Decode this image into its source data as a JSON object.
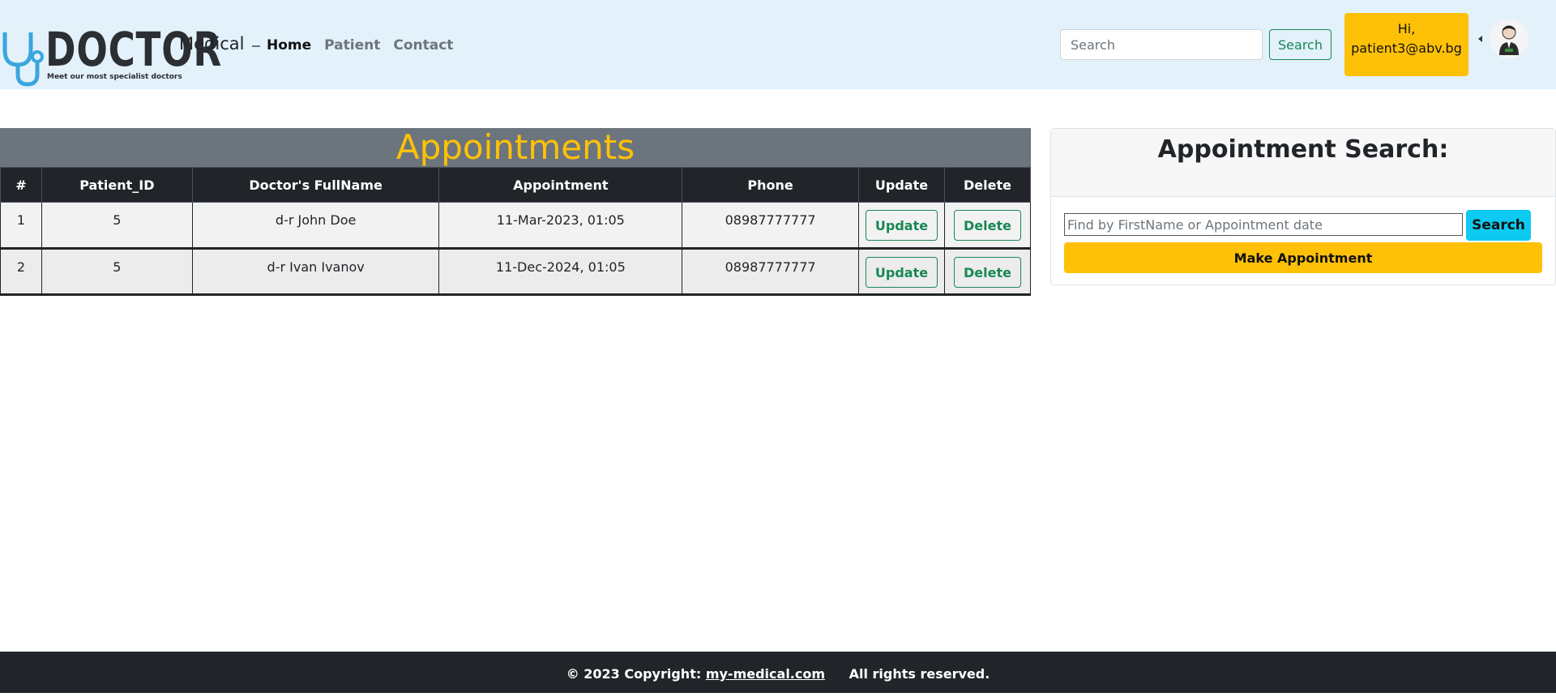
{
  "navbar": {
    "logo_word": "DOCTOR",
    "logo_tagline": "Meet our most specialist doctors",
    "brand": "Medical",
    "links": [
      {
        "label": "Home",
        "active": true
      },
      {
        "label": "Patient",
        "active": false
      },
      {
        "label": "Contact",
        "active": false
      }
    ],
    "search_placeholder": "Search",
    "search_button": "Search",
    "greeting_line1": "Hi,",
    "greeting_line2": "patient3@abv.bg"
  },
  "appointments": {
    "title": "Appointments",
    "columns": [
      "#",
      "Patient_ID",
      "Doctor's FullName",
      "Appointment",
      "Phone",
      "Update",
      "Delete"
    ],
    "rows": [
      {
        "num": "1",
        "patient_id": "5",
        "doctor": "d-r John Doe",
        "appointment": "11-Mar-2023, 01:05",
        "phone": "08987777777",
        "update": "Update",
        "delete": "Delete"
      },
      {
        "num": "2",
        "patient_id": "5",
        "doctor": "d-r Ivan Ivanov",
        "appointment": "11-Dec-2024, 01:05",
        "phone": "08987777777",
        "update": "Update",
        "delete": "Delete"
      }
    ]
  },
  "search_panel": {
    "title": "Appointment Search:",
    "input_placeholder": "Find by FirstName or Appointment date",
    "search_button": "Search",
    "make_button": "Make Appointment"
  },
  "footer": {
    "copyright": "© 2023 Copyright:",
    "site": "my-medical.com",
    "rights": "All rights reserved."
  },
  "colors": {
    "navbar_bg": "#e3f1fb",
    "accent_yellow": "#ffc107",
    "success_green": "#198754",
    "info_cyan": "#0dcaf0",
    "dark": "#212529"
  }
}
